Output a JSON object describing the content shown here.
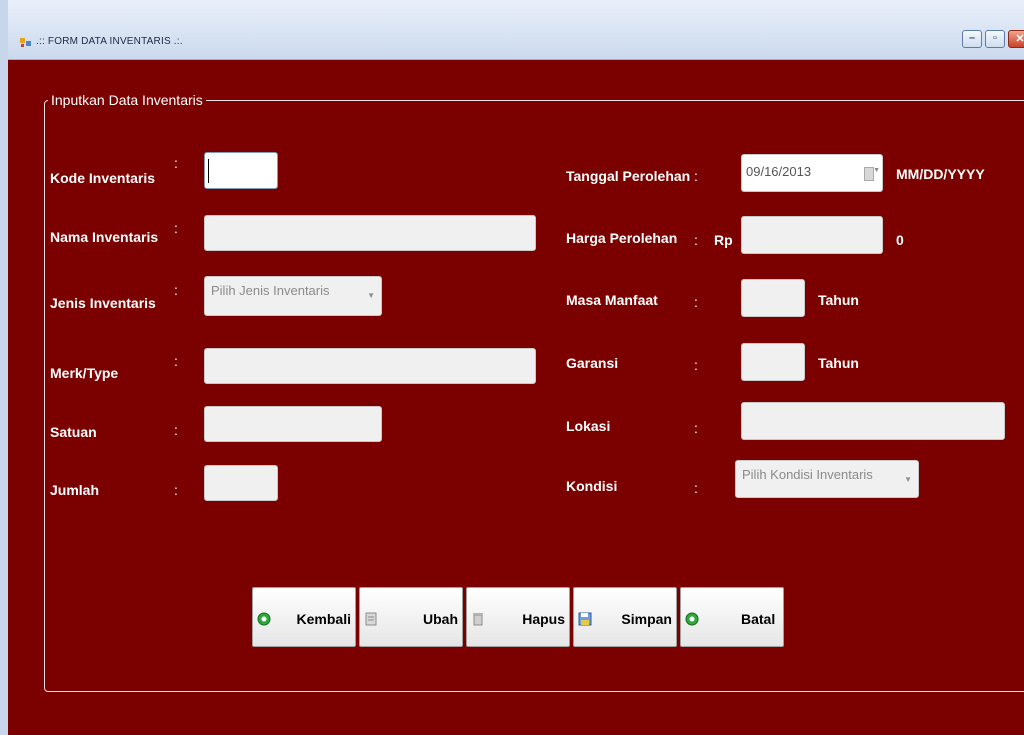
{
  "window": {
    "title": ".:: FORM DATA INVENTARIS .:."
  },
  "group": {
    "title": "Inputkan Data Inventaris"
  },
  "left_fields": {
    "kode": {
      "label": "Kode Inventaris",
      "value": ""
    },
    "nama": {
      "label": "Nama Inventaris",
      "value": ""
    },
    "jenis": {
      "label": "Jenis Inventaris",
      "selected": "Pilih Jenis Inventaris"
    },
    "merk": {
      "label": "Merk/Type",
      "value": ""
    },
    "satuan": {
      "label": "Satuan",
      "value": ""
    },
    "jumlah": {
      "label": "Jumlah",
      "value": ""
    }
  },
  "right_fields": {
    "tanggal": {
      "label": "Tanggal Perolehan",
      "value": "09/16/2013",
      "format": "MM/DD/YYYY"
    },
    "harga": {
      "label": "Harga Perolehan",
      "currency": "Rp",
      "value": "",
      "display": "0"
    },
    "masa": {
      "label": "Masa Manfaat",
      "value": "",
      "unit": "Tahun"
    },
    "garansi": {
      "label": "Garansi",
      "value": "",
      "unit": "Tahun"
    },
    "lokasi": {
      "label": "Lokasi",
      "value": ""
    },
    "kondisi": {
      "label": "Kondisi",
      "selected": "Pilih Kondisi Inventaris"
    }
  },
  "colon": ":",
  "buttons": {
    "kembali": "Kembali",
    "ubah": "Ubah",
    "hapus": "Hapus",
    "simpan": "Simpan",
    "batal": "Batal"
  },
  "icons": {
    "app": "app-icon",
    "minimize": "minimize-icon",
    "maximize": "maximize-icon",
    "close": "close-icon",
    "kembali": "green-circle-icon",
    "ubah": "document-icon",
    "hapus": "trash-icon",
    "simpan": "save-icon",
    "batal": "green-circle-icon"
  },
  "colors": {
    "background": "#7b0000",
    "label": "#ffffff",
    "field": "#f0f0f0"
  }
}
